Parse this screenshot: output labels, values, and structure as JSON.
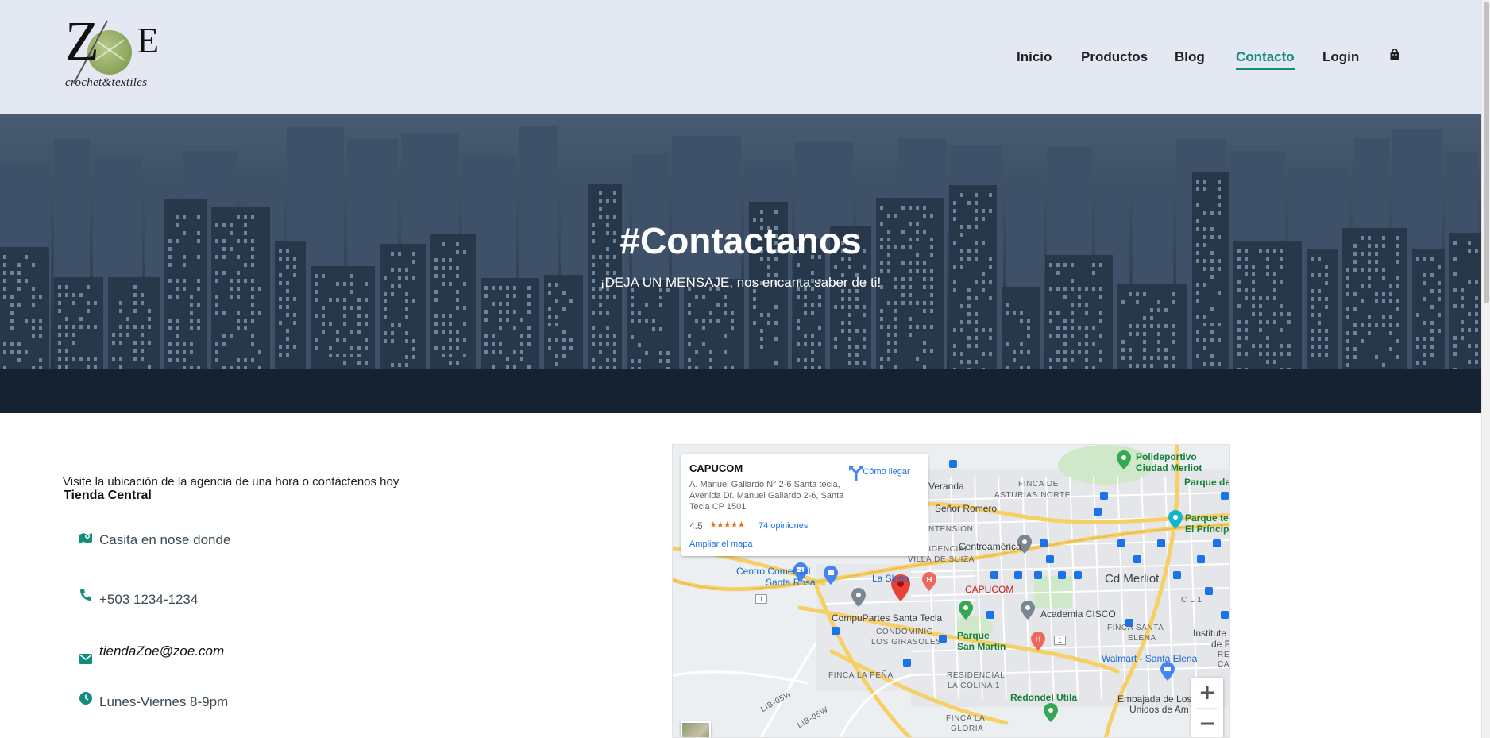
{
  "brand": {
    "logo_initial_left": "Z",
    "logo_initial_right": "E",
    "logo_tagline": "crochet&textiles"
  },
  "nav": {
    "items": [
      {
        "label": "Inicio",
        "active": false
      },
      {
        "label": "Productos",
        "active": false
      },
      {
        "label": "Blog",
        "active": false
      },
      {
        "label": "Contacto",
        "active": true
      },
      {
        "label": "Login",
        "active": false
      }
    ],
    "cart_icon": "shopping-bag-icon"
  },
  "hero": {
    "title": "#Contactanos",
    "subtitle": "¡DEJA UN MENSAJE, nos encanta saber de ti!"
  },
  "contact": {
    "intro": "Visite la ubicación de la agencia de una hora o contáctenos hoy",
    "store_name": "Tienda Central",
    "items": [
      {
        "icon": "map-marker-icon",
        "text": "Casita en nose donde"
      },
      {
        "icon": "phone-icon",
        "text": "+503 1234-1234"
      },
      {
        "icon": "envelope-icon",
        "text": "tiendaZoe@zoe.com"
      },
      {
        "icon": "clock-icon",
        "text": "Lunes-Viernes 8-9pm"
      }
    ]
  },
  "map": {
    "place_name": "CAPUCOM",
    "address": "A. Manuel Gallardo N° 2-6 Santa tecla, Avenida Dr. Manuel Gallardo 2-6, Santa Tecla CP 1501",
    "rating": "4.5",
    "stars": "★★★★★",
    "reviews": "74 opiniones",
    "directions": "Cómo llegar",
    "enlarge": "Ampliar el mapa",
    "zoom_in": "+",
    "zoom_out": "−",
    "labels": {
      "polideportivo": "Polideportivo",
      "ciudad_merliot": "Ciudad Merliot",
      "parque_de": "Parque de",
      "veranda": "Veranda",
      "finca_de": "FINCA DE",
      "asturias_norte": "ASTURIAS NORTE",
      "senor_romero": "Señor Romero",
      "parque_te": "Parque te",
      "el_principe": "El Príncipe",
      "ntension": "NTENSION",
      "residencial": "RESIDENCIAL",
      "villa_de_suiza": "VILLA DE SUIZA",
      "centroamerica": "Centroamérica",
      "centro_comercial": "Centro Comercial",
      "santa_rosa": "Santa Rosa",
      "la_skina": "La Skina",
      "capucom": "CAPUCOM",
      "cd_merliot": "Cd Merliot",
      "c_l_1": "C L 1",
      "compupartes": "CompuPartes Santa Tecla",
      "academia_cisco": "Academia CISCO",
      "condominio": "CONDOMINIO",
      "los_girasoles": "LOS GIRASOLES",
      "parque": "Parque",
      "san_martin": "San Martín",
      "finca_santa": "FINCA SANTA",
      "elena": "ELENA",
      "institute": "Institute",
      "de_f": "de F",
      "res": "RES",
      "ca": "CA",
      "walmart": "Walmart - Santa Elena",
      "finca_la_pena": "FINCA LA PEÑA",
      "residencial_2": "RESIDENCIAL",
      "la_colina": "LA COLINA 1",
      "redondel": "Redondel Utila",
      "embajada": "Embajada de Los Est",
      "unidos": "Unidos de Am",
      "finca_la": "FINCA LA",
      "gloria": "GLORIA",
      "road_1a": "1",
      "road_1b": "1",
      "lib05w_a": "LIB-05W",
      "lib05w_b": "LIB-05W"
    }
  },
  "colors": {
    "accent": "#128d7c",
    "header_bg": "#e3e8f3",
    "hero_dark": "#1b2a3b"
  }
}
